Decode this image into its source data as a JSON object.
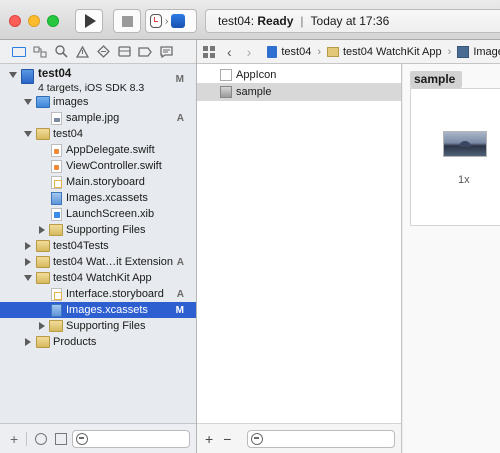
{
  "toolbar": {
    "status_project": "test04:",
    "status_state": "Ready",
    "status_separator": "|",
    "status_time": "Today at 17:36"
  },
  "navigator": {
    "tabs": [
      "folder-icon",
      "symbol-icon",
      "search-icon",
      "warning-icon",
      "test-icon",
      "debug-icon",
      "breakpoint-icon",
      "report-icon"
    ],
    "project": {
      "name": "test04",
      "subtitle": "4 targets, iOS SDK 8.3",
      "badge": "M"
    },
    "items": [
      {
        "label": "images",
        "badge": ""
      },
      {
        "label": "sample.jpg",
        "badge": "A"
      },
      {
        "label": "test04",
        "badge": ""
      },
      {
        "label": "AppDelegate.swift",
        "badge": ""
      },
      {
        "label": "ViewController.swift",
        "badge": ""
      },
      {
        "label": "Main.storyboard",
        "badge": ""
      },
      {
        "label": "Images.xcassets",
        "badge": ""
      },
      {
        "label": "LaunchScreen.xib",
        "badge": ""
      },
      {
        "label": "Supporting Files",
        "badge": ""
      },
      {
        "label": "test04Tests",
        "badge": ""
      },
      {
        "label": "test04 Wat…it Extension",
        "badge": "A"
      },
      {
        "label": "test04 WatchKit App",
        "badge": ""
      },
      {
        "label": "Interface.storyboard",
        "badge": "A"
      },
      {
        "label": "Images.xcassets",
        "badge": "M"
      },
      {
        "label": "Supporting Files",
        "badge": ""
      },
      {
        "label": "Products",
        "badge": ""
      }
    ],
    "footer": {
      "add": "+"
    }
  },
  "jumpbar": {
    "crumbs": [
      "test04",
      "test04 WatchKit App",
      "Images"
    ]
  },
  "assets": {
    "items": [
      "AppIcon",
      "sample"
    ],
    "footer": {
      "add": "+",
      "remove": "−"
    }
  },
  "detail": {
    "set_name": "sample",
    "scale_label": "1x"
  }
}
